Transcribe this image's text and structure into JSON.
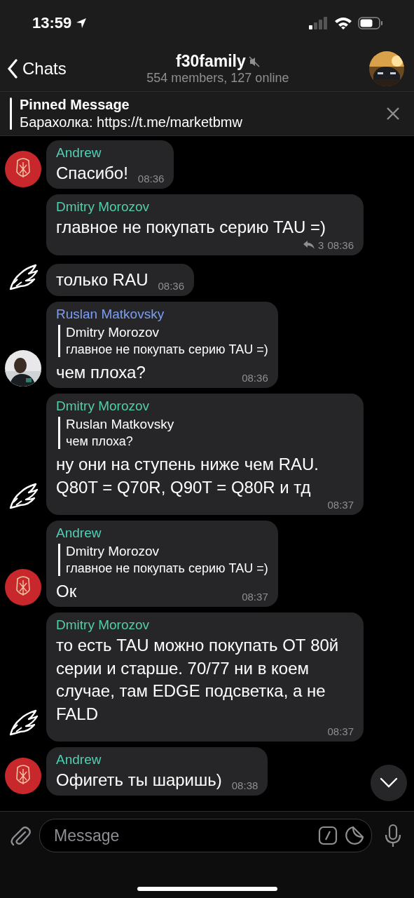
{
  "status_bar": {
    "time": "13:59"
  },
  "header": {
    "back": "Chats",
    "title": "f30family",
    "muted": true,
    "subtitle": "554 members, 127 online"
  },
  "pinned": {
    "title": "Pinned Message",
    "text": "Барахолка: https://t.me/marketbmw"
  },
  "messages": [
    {
      "sender": "Andrew",
      "color": "#4fd1b5",
      "text": "Спасибо!",
      "time": "08:36",
      "kind": "emblem"
    },
    {
      "sender": "Dmitry Morozov",
      "color": "#4fcfa9",
      "text": "главное не покупать серию TAU =)",
      "time": "08:36",
      "replies": "3",
      "kind": "plain"
    },
    {
      "text": "только RAU",
      "time": "08:36",
      "kind": "wing"
    },
    {
      "sender": "Ruslan Matkovsky",
      "color": "#7b9ff0",
      "reply": {
        "name": "Dmitry Morozov",
        "text": "главное не покупать серию TAU =)"
      },
      "text": "чем плоха?",
      "time": "08:36"
    },
    {
      "sender": "Dmitry Morozov",
      "color": "#4fcfa9",
      "reply": {
        "name": "Ruslan Matkovsky",
        "text": "чем плоха?"
      },
      "text": "ну они на ступень ниже чем RAU. Q80T = Q70R, Q90T = Q80R и тд",
      "time": "08:37",
      "kind": "wing"
    },
    {
      "sender": "Andrew",
      "color": "#4fd1b5",
      "reply": {
        "name": "Dmitry Morozov",
        "text": "главное не покупать серию TAU =)"
      },
      "text": "Ок",
      "time": "08:37",
      "kind": "emblem"
    },
    {
      "sender": "Dmitry Morozov",
      "color": "#4fcfa9",
      "text": "то есть TAU можно покупать ОТ 80й серии и старше. 70/77 ни в коем случае, там EDGE подсветка, а не FALD",
      "time": "08:37",
      "kind": "wing"
    },
    {
      "sender": "Andrew",
      "color": "#4fd1b5",
      "text": "Офигеть ты шаришь)",
      "time": "08:38",
      "kind": "emblem"
    }
  ],
  "composer": {
    "placeholder": "Message"
  }
}
